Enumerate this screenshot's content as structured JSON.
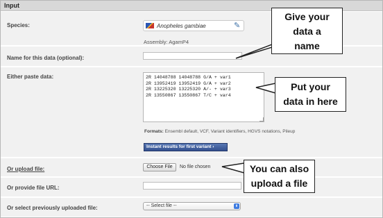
{
  "section_title": "Input",
  "species": {
    "label": "Species:",
    "value": "Anopheles gambiae",
    "assembly": "Assembly: AgamP4"
  },
  "name_field": {
    "label": "Name for this data (optional):",
    "value": ""
  },
  "paste": {
    "label": "Either paste data:",
    "value": "2R 14048788 14048788 G/A + var1\n2R 13952419 13952419 G/A + var2\n2R 13225320 13225320 A/- + var3\n2R 13550867 13550867 T/C + var4",
    "formats_label": "Formats:",
    "formats_value": "Ensembl default, VCF, Variant identifiers, HGVS notations, Pileup",
    "instant_button": "Instant results for first variant ›"
  },
  "upload": {
    "label": "Or upload file:",
    "button": "Choose File",
    "status": "No file chosen"
  },
  "url_field": {
    "label": "Or provide file URL:",
    "value": ""
  },
  "previous": {
    "label": "Or select previously uploaded file:",
    "selected": "-- Select file --"
  },
  "callouts": {
    "name": [
      "Give your",
      "data a",
      "name"
    ],
    "paste": [
      "Put your",
      "data in here"
    ],
    "upload": [
      "You can also",
      "upload a file"
    ]
  },
  "icons": {
    "species_flag": "species-flag-icon",
    "edit": "pencil-icon",
    "select_arrow": "chevron-updown-icon"
  }
}
